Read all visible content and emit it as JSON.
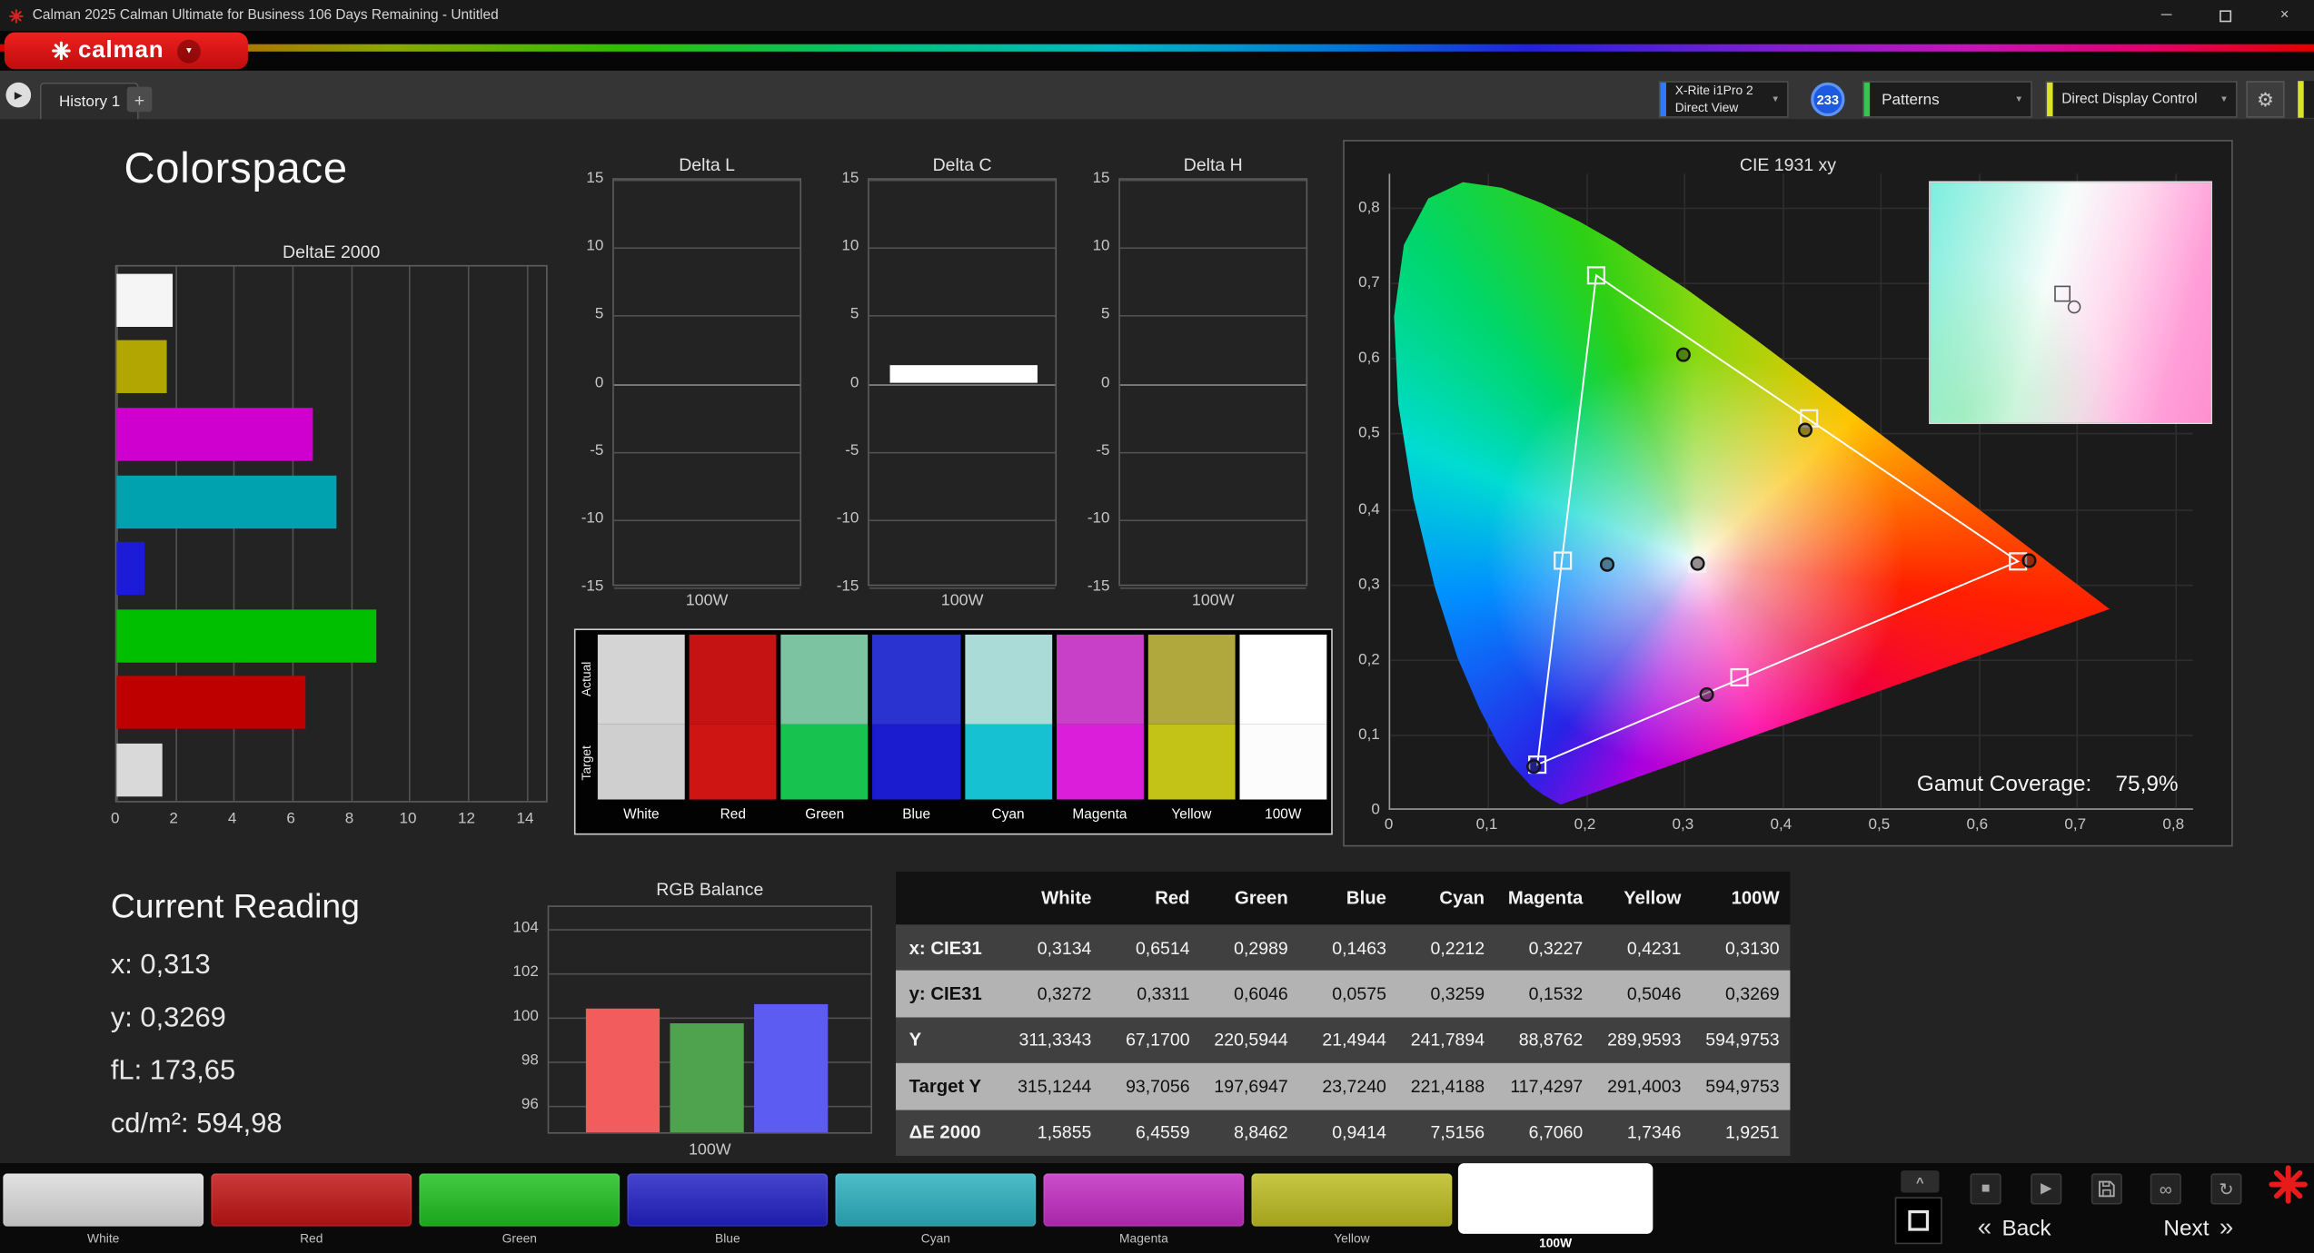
{
  "window": {
    "title": "Calman 2025 Calman Ultimate for Business 106 Days Remaining  - Untitled"
  },
  "brand": {
    "logo_text": "calman"
  },
  "tab_bar": {
    "history_tab": "History 1",
    "add_tab": "+"
  },
  "toolbar": {
    "meter_line1": "X-Rite i1Pro 2",
    "meter_line2": "Direct View",
    "meter_badge": "233",
    "patterns_label": "Patterns",
    "display_control_label": "Direct Display Control"
  },
  "page": {
    "title": "Colorspace"
  },
  "icons": {
    "dropdown_arrow": "▼",
    "expander_play": "▶",
    "gear": "⚙",
    "minimize": "─",
    "close": "×",
    "stop": "■",
    "play": "▶",
    "link": "∞",
    "refresh": "↻",
    "chevron_up": "^",
    "back": "«",
    "next": "»"
  },
  "current_reading": {
    "title": "Current Reading",
    "lines": [
      "x: 0,313",
      "y: 0,3269",
      "fL: 173,65",
      "cd/m²: 594,98"
    ]
  },
  "chart_data": [
    {
      "id": "deltae2000",
      "type": "bar",
      "orientation": "horizontal",
      "title": "DeltaE 2000",
      "xlim": [
        0,
        14
      ],
      "xticks": [
        0,
        2,
        4,
        6,
        8,
        10,
        12,
        14
      ],
      "bars": [
        {
          "name": "100W",
          "value": 1.9251,
          "color": "#f5f5f5"
        },
        {
          "name": "Yellow",
          "value": 1.7346,
          "color": "#b1a602"
        },
        {
          "name": "Magenta",
          "value": 6.706,
          "color": "#cf00cf"
        },
        {
          "name": "Cyan",
          "value": 7.5156,
          "color": "#00a2af"
        },
        {
          "name": "Blue",
          "value": 0.9414,
          "color": "#1b1bd8"
        },
        {
          "name": "Green",
          "value": 8.8462,
          "color": "#00bf00"
        },
        {
          "name": "Red",
          "value": 6.4559,
          "color": "#bf0000"
        },
        {
          "name": "White",
          "value": 1.5855,
          "color": "#d9d9d9"
        }
      ]
    },
    {
      "id": "delta_l",
      "type": "bar",
      "title": "Delta L",
      "ylim": [
        -15,
        15
      ],
      "yticks": [
        15,
        10,
        5,
        0,
        -5,
        -10,
        -15
      ],
      "categories": [
        "100W"
      ],
      "xlabel": "100W",
      "values": [
        0
      ],
      "bar_visible": false
    },
    {
      "id": "delta_c",
      "type": "bar",
      "title": "Delta C",
      "ylim": [
        -15,
        15
      ],
      "yticks": [
        15,
        10,
        5,
        0,
        -5,
        -10,
        -15
      ],
      "categories": [
        "100W"
      ],
      "xlabel": "100W",
      "values": [
        1.3
      ],
      "bar_visible": true,
      "bar_color": "#ffffff"
    },
    {
      "id": "delta_h",
      "type": "bar",
      "title": "Delta H",
      "ylim": [
        -15,
        15
      ],
      "yticks": [
        15,
        10,
        5,
        0,
        -5,
        -10,
        -15
      ],
      "categories": [
        "100W"
      ],
      "xlabel": "100W",
      "values": [
        0
      ],
      "bar_visible": false
    },
    {
      "id": "rgb_balance",
      "type": "bar",
      "title": "RGB Balance",
      "ylim": [
        94.7,
        105
      ],
      "yticks": [
        104,
        102,
        100,
        98,
        96
      ],
      "xlabel": "100W",
      "bars": [
        {
          "name": "Red",
          "value": 100.3,
          "color": "#f25c5c"
        },
        {
          "name": "Green",
          "value": 99.6,
          "color": "#4fa34f"
        },
        {
          "name": "Blue",
          "value": 100.5,
          "color": "#5c5cf2"
        }
      ]
    },
    {
      "id": "cie1931",
      "type": "scatter",
      "title": "CIE 1931 xy",
      "xlim": [
        0,
        0.82
      ],
      "ylim": [
        0,
        0.845
      ],
      "tick_step": 0.1,
      "xtick_labels": [
        "0",
        "0,1",
        "0,2",
        "0,3",
        "0,4",
        "0,5",
        "0,6",
        "0,7",
        "0,8"
      ],
      "ytick_labels": [
        "0",
        "0,1",
        "0,2",
        "0,3",
        "0,4",
        "0,5",
        "0,6",
        "0,7",
        "0,8"
      ],
      "target_triangle": [
        [
          0.21,
          0.71
        ],
        [
          0.64,
          0.33
        ],
        [
          0.15,
          0.06
        ]
      ],
      "target_points": [
        [
          0.21,
          0.71
        ],
        [
          0.427,
          0.52
        ],
        [
          0.64,
          0.33
        ],
        [
          0.356,
          0.176
        ],
        [
          0.15,
          0.06
        ],
        [
          0.176,
          0.331
        ],
        [
          0.313,
          0.327
        ]
      ],
      "measured_points": [
        [
          0.3134,
          0.3272
        ],
        [
          0.6514,
          0.3311
        ],
        [
          0.2989,
          0.6046
        ],
        [
          0.1463,
          0.0575
        ],
        [
          0.2212,
          0.3259
        ],
        [
          0.3227,
          0.1532
        ],
        [
          0.4231,
          0.5046
        ]
      ],
      "gamut_coverage_label": "Gamut Coverage:",
      "gamut_coverage_value": "75,9%"
    }
  ],
  "swatch_panel": {
    "row_labels": [
      "Actual",
      "Target"
    ],
    "columns": [
      {
        "label": "White",
        "actual": "#d4d4d4",
        "target": "#cfcfcf"
      },
      {
        "label": "Red",
        "actual": "#c51313",
        "target": "#cf1414"
      },
      {
        "label": "Green",
        "actual": "#7cc3a2",
        "target": "#17c24e"
      },
      {
        "label": "Blue",
        "actual": "#2a33cf",
        "target": "#1b1bcf"
      },
      {
        "label": "Cyan",
        "actual": "#abdbd6",
        "target": "#16c2d2"
      },
      {
        "label": "Magenta",
        "actual": "#c740c7",
        "target": "#da1eda"
      },
      {
        "label": "Yellow",
        "actual": "#b0a73d",
        "target": "#c2c217"
      },
      {
        "label": "100W",
        "actual": "#ffffff",
        "target": "#fcfcfc"
      }
    ]
  },
  "measurement_table": {
    "headers": [
      "White",
      "Red",
      "Green",
      "Blue",
      "Cyan",
      "Magenta",
      "Yellow",
      "100W"
    ],
    "rows": [
      {
        "label": "x: CIE31",
        "values": [
          "0,3134",
          "0,6514",
          "0,2989",
          "0,1463",
          "0,2212",
          "0,3227",
          "0,4231",
          "0,3130"
        ]
      },
      {
        "label": "y: CIE31",
        "values": [
          "0,3272",
          "0,3311",
          "0,6046",
          "0,0575",
          "0,3259",
          "0,1532",
          "0,5046",
          "0,3269"
        ]
      },
      {
        "label": "Y",
        "values": [
          "311,3343",
          "67,1700",
          "220,5944",
          "21,4944",
          "241,7894",
          "88,8762",
          "289,9593",
          "594,9753"
        ]
      },
      {
        "label": "Target Y",
        "values": [
          "315,1244",
          "93,7056",
          "197,6947",
          "23,7240",
          "221,4188",
          "117,4297",
          "291,4003",
          "594,9753"
        ]
      },
      {
        "label": "ΔE 2000",
        "values": [
          "1,5855",
          "6,4559",
          "8,8462",
          "0,9414",
          "7,5156",
          "6,7060",
          "1,7346",
          "1,9251"
        ]
      }
    ]
  },
  "bottom_bar": {
    "swatches": [
      {
        "label": "White",
        "color": "#dcdcdc"
      },
      {
        "label": "Red",
        "color": "#c11414"
      },
      {
        "label": "Green",
        "color": "#1fc01f"
      },
      {
        "label": "Blue",
        "color": "#2121c6"
      },
      {
        "label": "Cyan",
        "color": "#2cb0c0"
      },
      {
        "label": "Magenta",
        "color": "#c32cc3"
      },
      {
        "label": "Yellow",
        "color": "#bcbc20"
      },
      {
        "label": "100W",
        "color": "#ffffff",
        "selected": true
      }
    ],
    "back_label": "Back",
    "next_label": "Next"
  }
}
